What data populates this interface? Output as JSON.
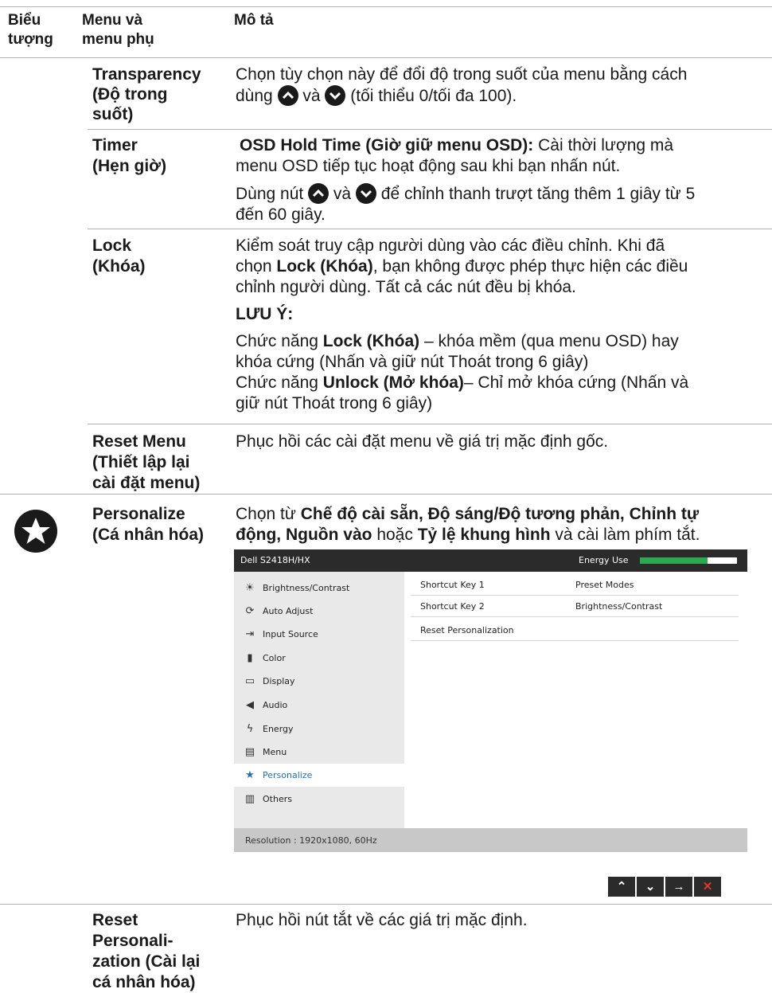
{
  "header": {
    "col1": "Biểu tượng",
    "col1_a": "Biểu",
    "col1_b": "tượng",
    "col2_a": "Menu và",
    "col2_b": "menu phụ",
    "col3": "Mô tả"
  },
  "rows": {
    "transparency": {
      "name_a": "Transparency",
      "name_b": "(Độ trong",
      "name_c": "suốt)",
      "desc_a": "Chọn tùy chọn này để đổi độ trong suốt của menu bằng cách",
      "desc_b1": "dùng",
      "desc_b2": "và",
      "desc_b3": "(tối thiểu 0/tối đa 100)."
    },
    "timer": {
      "name_a": "Timer",
      "name_b": "(Hẹn giờ)",
      "osd_bold": "OSD Hold Time (Giờ giữ menu OSD):",
      "osd_rest": " Cài thời lượng mà",
      "line2": "menu OSD tiếp tục hoạt động sau khi bạn nhấn nút.",
      "line3_a": "Dùng nút",
      "line3_b": "và",
      "line3_c": "để chỉnh thanh trượt tăng thêm 1 giây từ 5",
      "line4": "đến 60 giây."
    },
    "lock": {
      "name_a": "Lock",
      "name_b": "(Khóa)",
      "l1": "Kiểm soát truy cập người dùng vào các điều chỉnh. Khi đã",
      "l2a": "chọn ",
      "l2b": "Lock (Khóa)",
      "l2c": ", bạn không được phép thực hiện các điều",
      "l3": "chỉnh người dùng. Tất cả các nút đều bị khóa.",
      "note": "LƯU Ý:",
      "n1a": "Chức năng ",
      "n1b": "Lock (Khóa)",
      "n1c": " – khóa mềm (qua menu OSD) hay",
      "n2": "khóa cứng (Nhấn và giữ nút Thoát trong 6 giây)",
      "n3a": "Chức năng ",
      "n3b": "Unlock (Mở khóa)",
      "n3c": "– Chỉ mở khóa cứng (Nhấn và",
      "n4": "giữ nút Thoát trong 6 giây)"
    },
    "reset_menu": {
      "name_a": "Reset Menu",
      "name_b": "(Thiết lập lại",
      "name_c": "cài đặt menu)",
      "desc": "Phục hồi các cài đặt menu về giá trị mặc định gốc."
    },
    "personalize": {
      "name_a": "Personalize",
      "name_b": "(Cá nhân hóa)",
      "d1a": "Chọn từ ",
      "d1b": "Chế độ cài sẵn, Độ sáng/Độ tương phản, Chỉnh tự",
      "d2a": "động, Nguồn vào",
      "d2b": " hoặc ",
      "d2c": "Tỷ lệ khung hình",
      "d2d": " và cài làm phím tắt."
    },
    "reset_personalization": {
      "name_a": "Reset",
      "name_b": "Personali-",
      "name_c": "zation (Cài lại",
      "name_d": "cá nhân hóa)",
      "desc": "Phục hồi nút tắt về các giá trị mặc định."
    }
  },
  "osd": {
    "model": "Dell S2418H/HX",
    "energy_label": "Energy Use",
    "energy_level": 0.7,
    "menu": [
      {
        "label": "Brightness/Contrast",
        "icon": "sun-icon"
      },
      {
        "label": "Auto Adjust",
        "icon": "auto-adjust-icon"
      },
      {
        "label": "Input Source",
        "icon": "input-source-icon"
      },
      {
        "label": "Color",
        "icon": "color-icon"
      },
      {
        "label": "Display",
        "icon": "display-icon"
      },
      {
        "label": "Audio",
        "icon": "speaker-icon"
      },
      {
        "label": "Energy",
        "icon": "energy-icon"
      },
      {
        "label": "Menu",
        "icon": "menu-icon"
      },
      {
        "label": "Personalize",
        "icon": "star-icon",
        "selected": true
      },
      {
        "label": "Others",
        "icon": "others-icon"
      }
    ],
    "right": [
      {
        "key": "Shortcut Key 1",
        "value": "Preset Modes"
      },
      {
        "key": "Shortcut Key 2",
        "value": "Brightness/Contrast"
      },
      {
        "key": "Reset Personalization",
        "value": ""
      }
    ],
    "resolution": "Resolution : 1920x1080, 60Hz"
  },
  "nav_buttons": [
    {
      "symbol": "⌃",
      "icon": "chevron-up-icon"
    },
    {
      "symbol": "⌄",
      "icon": "chevron-down-icon"
    },
    {
      "symbol": "→",
      "icon": "arrow-right-icon"
    },
    {
      "symbol": "✕",
      "icon": "close-icon"
    }
  ]
}
